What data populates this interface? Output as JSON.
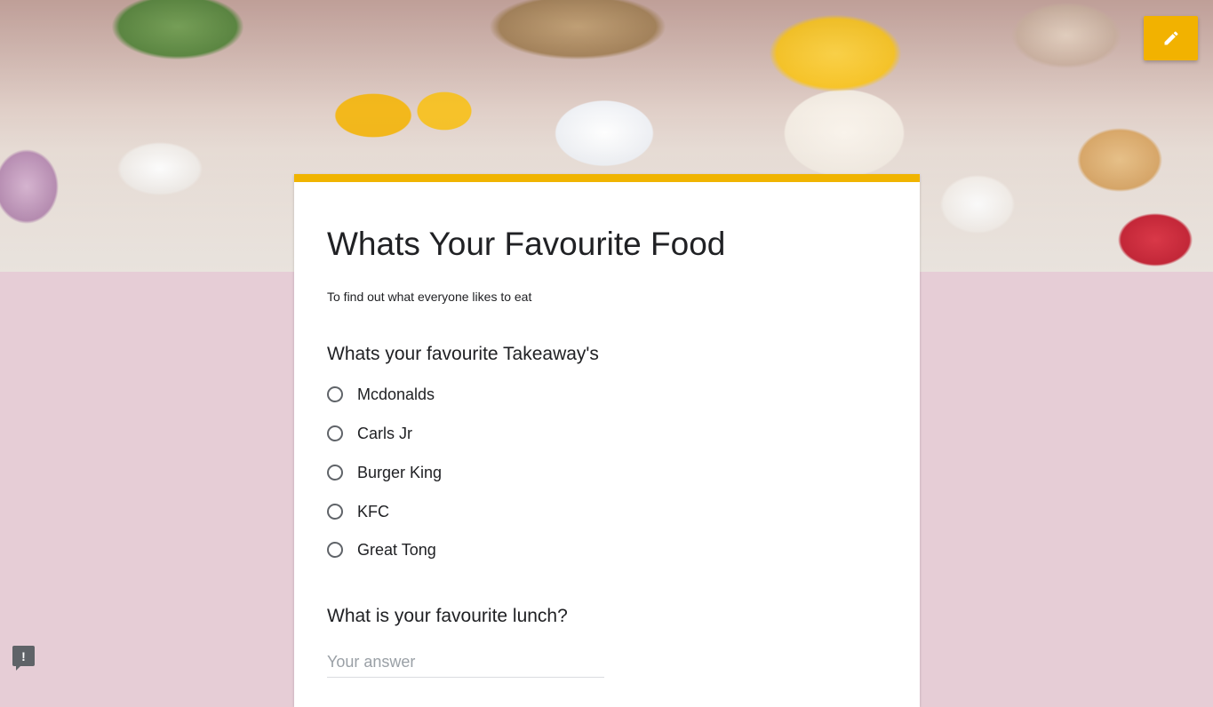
{
  "header": {
    "image_alt": "Afternoon tea table with cakes, macarons and floral teacups"
  },
  "toolbar": {
    "edit_icon": "pencil-icon"
  },
  "theme": {
    "accent": "#f0b400",
    "background": "#e6cdd6"
  },
  "form": {
    "title": "Whats Your Favourite Food",
    "description": "To find out what everyone likes to eat"
  },
  "questions": [
    {
      "title": "Whats your favourite Takeaway's",
      "type": "radio",
      "options": [
        "Mcdonalds",
        "Carls Jr",
        "Burger King",
        "KFC",
        "Great Tong"
      ]
    },
    {
      "title": "What is your favourite lunch?",
      "type": "short-answer",
      "placeholder": "Your answer",
      "value": ""
    }
  ],
  "footer": {
    "report_icon": "report-issue-icon",
    "report_glyph": "!"
  }
}
